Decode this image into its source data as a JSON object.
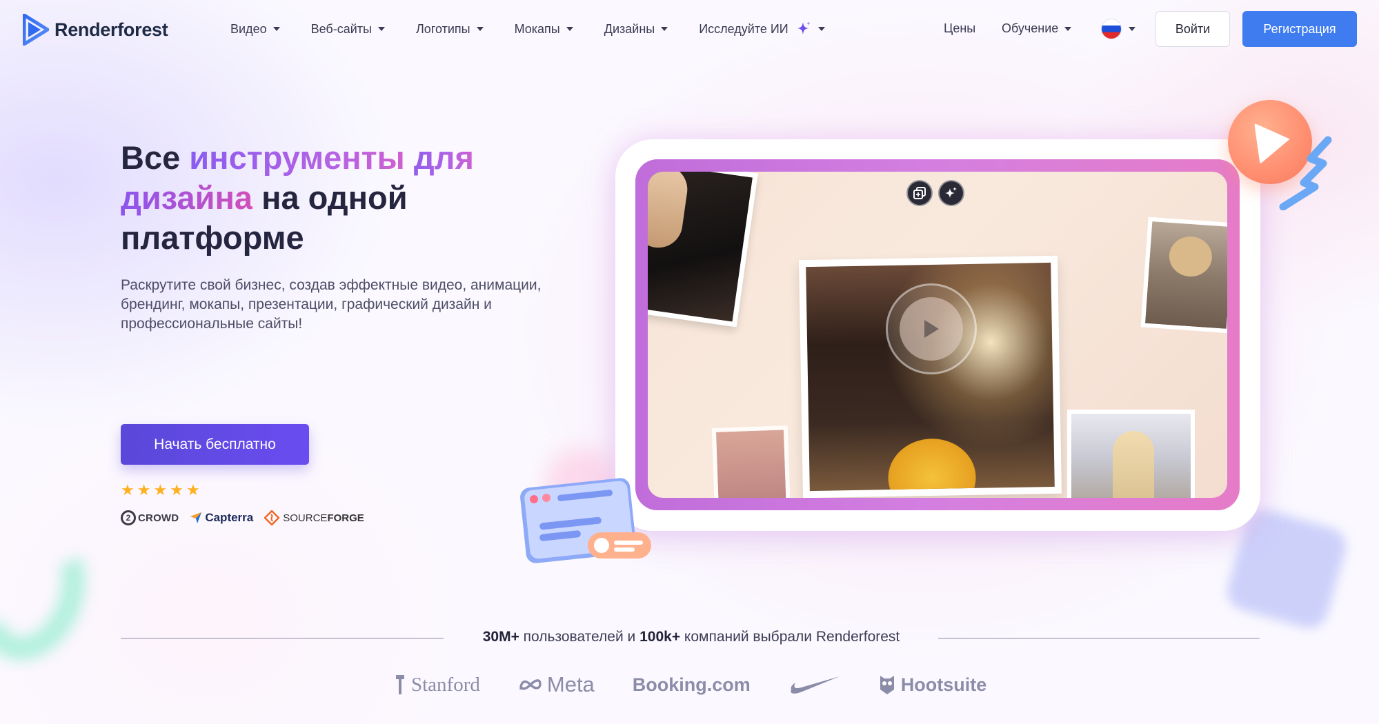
{
  "brand": {
    "name": "Renderforest",
    "accent": "#3e7cf0",
    "cta_color": "#5a48d9"
  },
  "nav": {
    "items": [
      {
        "label": "Видео"
      },
      {
        "label": "Веб-сайты"
      },
      {
        "label": "Логотипы"
      },
      {
        "label": "Мокапы"
      },
      {
        "label": "Дизайны"
      },
      {
        "label": "Исследуйте ИИ"
      }
    ],
    "prices": "Цены",
    "learning": "Обучение",
    "language_flag": "russian-flag-icon",
    "login": "Войти",
    "register": "Регистрация"
  },
  "hero": {
    "title_part1": "Все ",
    "title_part2": "инструменты",
    "title_part3": " для",
    "title_part4": "дизайна",
    "title_part5": " на одной платформе",
    "subtitle": "Раскрутите свой бизнес, создав эффектные видео, анимации, брендинг, мокапы, презентации, графический дизайн и профессиональные сайты!",
    "cta": "Начать бесплатно",
    "rating_stars": 5,
    "review_sites": {
      "g2": "CROWD",
      "capterra": "Capterra",
      "sourceforge_a": "SOURCE",
      "sourceforge_b": "FORGE"
    }
  },
  "trust": {
    "users": "30M+",
    "users_text": " пользователей и ",
    "companies": "100k+",
    "companies_text": " компаний выбрали Renderforest",
    "brands": [
      "Stanford",
      "Meta",
      "Booking.com",
      "Nike",
      "Hootsuite"
    ]
  }
}
